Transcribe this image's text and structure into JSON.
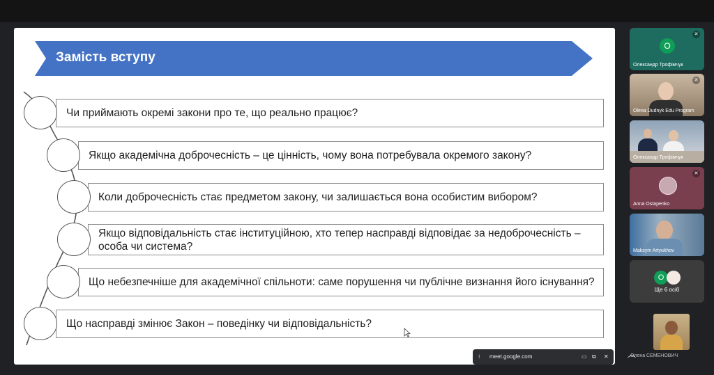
{
  "slide": {
    "title": "Замість вступу",
    "colors": {
      "banner": "#4472c4",
      "text": "#1f1f1f"
    },
    "questions": [
      "Чи приймають окремі закони про те, що реально працює?",
      "Якщо академічна доброчесність – це цінність, чому вона потребувала окремого закону?",
      "Коли доброчесність стає предметом закону, чи залишається вона особистим вибором?",
      "Якщо відповідальність стає інституційною, хто тепер насправді відповідає за недоброчесність – особа чи система?",
      "Що небезпечніше для академічної спільноти: саме порушення чи публічне визнання його існування?",
      "Що насправді змінює Закон – поведінку чи відповідальність?"
    ]
  },
  "participants": [
    {
      "name": "Олександр Трофімчук",
      "initial": "О",
      "bg": "#1e6b5f",
      "avatar": "#0f9d58"
    },
    {
      "name": "Olena Dudnyk Edu Program",
      "bg": "#6b5a4a"
    },
    {
      "name": "Олександр Трофімчук",
      "bg": "#4a5568"
    },
    {
      "name": "Anna Ostapenko",
      "bg": "#7a3f4f"
    },
    {
      "name": "Maksym Artyukhov",
      "bg": "#5b6d7d"
    },
    {
      "name": "Ще 6 осіб",
      "initial": "О",
      "bg": "#3c3c3c",
      "avatar": "#0f9d58"
    }
  ],
  "self_tile": {
    "name": "Олена СЕМЕНОВИЧ"
  },
  "share_bar": {
    "url": "meet.google.com"
  },
  "icons": [
    "mic-off-icon",
    "cursor-icon",
    "caret-up-icon",
    "stop-share-icon",
    "close-icon"
  ]
}
